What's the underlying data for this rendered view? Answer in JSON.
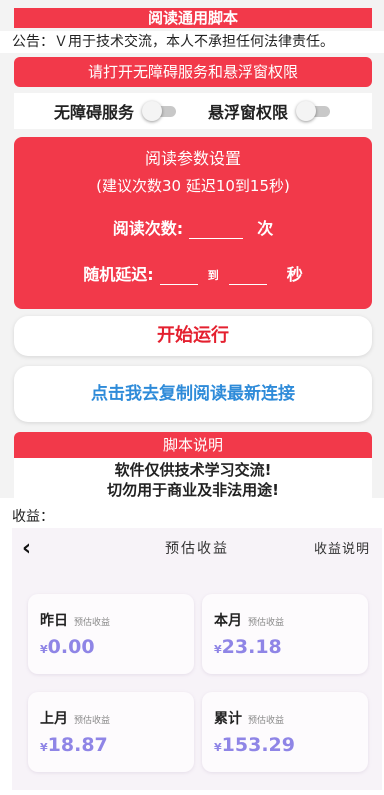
{
  "app": {
    "title": "阅读通用脚本",
    "notice": "公告：Ｖ用于技术交流，本人不承担任何法律责任。",
    "permission_banner": "请打开无障碍服务和悬浮窗权限",
    "toggles": [
      {
        "label": "无障碍服务",
        "on": false
      },
      {
        "label": "悬浮窗权限",
        "on": false
      }
    ],
    "params": {
      "title": "阅读参数设置",
      "hint": "(建议次数30  延迟10到15秒)",
      "count_label": "阅读次数:",
      "count_value": "",
      "count_unit": "次",
      "delay_label": "随机延迟:",
      "delay_min": "",
      "delay_to": "到",
      "delay_max": "",
      "delay_unit": "秒"
    },
    "start_button": "开始运行",
    "copy_button": "点击我去复制阅读最新连接",
    "script_info": {
      "header": "脚本说明",
      "line1": "软件仅供技术学习交流!",
      "line2": "切勿用于商业及非法用途!"
    }
  },
  "income_label": "收益：",
  "income": {
    "back_icon": "chevron-left-icon",
    "title": "预估收益",
    "help": "收益说明",
    "currency": "¥",
    "accent_color": "#8f85e6",
    "cards": [
      {
        "name": "昨日",
        "sub": "预估收益",
        "value": "0.00"
      },
      {
        "name": "本月",
        "sub": "预估收益",
        "value": "23.18"
      },
      {
        "name": "上月",
        "sub": "预估收益",
        "value": "18.87"
      },
      {
        "name": "累计",
        "sub": "预估收益",
        "value": "153.29"
      }
    ]
  },
  "colors": {
    "primary_red": "#f2394a",
    "link_blue": "#2e8bd9",
    "start_red": "#e4202f"
  }
}
